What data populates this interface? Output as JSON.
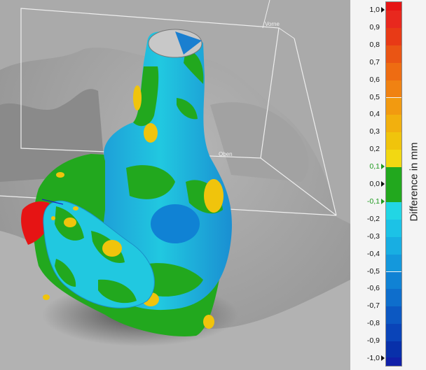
{
  "viewport": {
    "plane_labels": {
      "top": "Vorne",
      "bottom": "Oben"
    }
  },
  "legend": {
    "title": "Difference in mm",
    "ticks": [
      {
        "label": "1,0",
        "value": 1.0,
        "color": "dark"
      },
      {
        "label": "0,9",
        "value": 0.9
      },
      {
        "label": "0,8",
        "value": 0.8
      },
      {
        "label": "0,7",
        "value": 0.7
      },
      {
        "label": "0,6",
        "value": 0.6
      },
      {
        "label": "0,5",
        "value": 0.5
      },
      {
        "label": "0,4",
        "value": 0.4
      },
      {
        "label": "0,3",
        "value": 0.3
      },
      {
        "label": "0,2",
        "value": 0.2
      },
      {
        "label": "0,1",
        "value": 0.1,
        "color": "green"
      },
      {
        "label": "0,0",
        "value": 0.0,
        "color": "dark"
      },
      {
        "label": "-0,1",
        "value": -0.1,
        "color": "green"
      },
      {
        "label": "-0,2",
        "value": -0.2
      },
      {
        "label": "-0,3",
        "value": -0.3
      },
      {
        "label": "-0,4",
        "value": -0.4
      },
      {
        "label": "-0,5",
        "value": -0.5
      },
      {
        "label": "-0,6",
        "value": -0.6
      },
      {
        "label": "-0,7",
        "value": -0.7
      },
      {
        "label": "-0,8",
        "value": -0.8
      },
      {
        "label": "-0,9",
        "value": -0.9
      },
      {
        "label": "-1,0",
        "value": -1.0,
        "color": "dark"
      }
    ],
    "bins": [
      {
        "from": 1.0,
        "to": 0.9,
        "color": "#e8281e"
      },
      {
        "from": 0.9,
        "to": 0.8,
        "color": "#e83a16"
      },
      {
        "from": 0.8,
        "to": 0.7,
        "color": "#ea5514"
      },
      {
        "from": 0.7,
        "to": 0.6,
        "color": "#ee6c12"
      },
      {
        "from": 0.6,
        "to": 0.5,
        "color": "#f08212"
      },
      {
        "from": 0.5,
        "to": 0.4,
        "color": "#f29a10"
      },
      {
        "from": 0.4,
        "to": 0.3,
        "color": "#f2b00e"
      },
      {
        "from": 0.3,
        "to": 0.2,
        "color": "#f0c40c"
      },
      {
        "from": 0.2,
        "to": 0.1,
        "color": "#f2d812"
      },
      {
        "from": 0.1,
        "to": -0.1,
        "color": "#22a81e"
      },
      {
        "from": -0.1,
        "to": -0.2,
        "color": "#22d6e4"
      },
      {
        "from": -0.2,
        "to": -0.3,
        "color": "#1cc2e6"
      },
      {
        "from": -0.3,
        "to": -0.4,
        "color": "#18aee2"
      },
      {
        "from": -0.4,
        "to": -0.5,
        "color": "#1498dc"
      },
      {
        "from": -0.5,
        "to": -0.6,
        "color": "#1082d4"
      },
      {
        "from": -0.6,
        "to": -0.7,
        "color": "#0e6ecc"
      },
      {
        "from": -0.7,
        "to": -0.8,
        "color": "#0c58c2"
      },
      {
        "from": -0.8,
        "to": -0.9,
        "color": "#0a44b8"
      },
      {
        "from": -0.9,
        "to": -1.0,
        "color": "#0830aa"
      }
    ],
    "over_color": "#e61414",
    "under_color": "#1020a8",
    "range": [
      -1.0,
      1.0
    ]
  }
}
